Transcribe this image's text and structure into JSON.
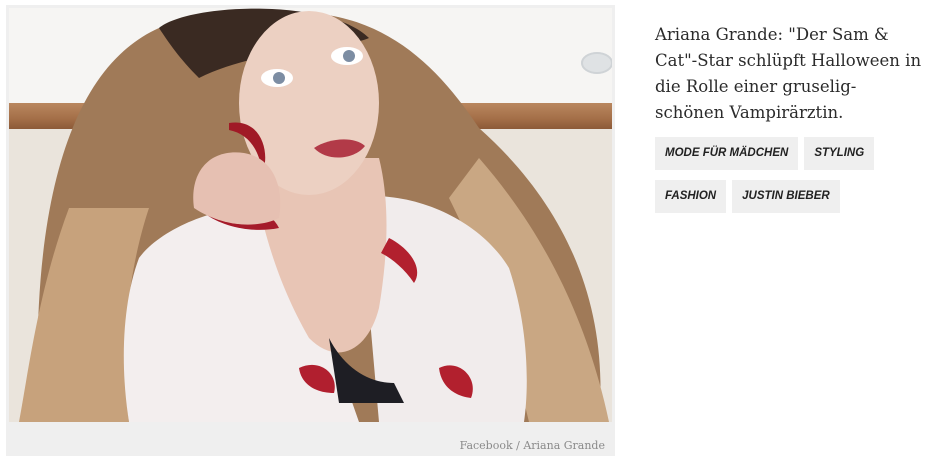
{
  "article": {
    "title": "Ariana Grande: \"Der Sam & Cat\"-Star schlüpft Halloween in die Rolle einer gruselig-schönen Vampirärztin.",
    "image_credit": "Facebook / Ariana Grande"
  },
  "tags": [
    {
      "label": "Mode für Mädchen"
    },
    {
      "label": "Styling"
    },
    {
      "label": "Fashion"
    },
    {
      "label": "Justin Bieber"
    }
  ],
  "colors": {
    "tag_background": "#efefef",
    "text": "#2b2b2b",
    "credit": "#8a8a8a"
  }
}
